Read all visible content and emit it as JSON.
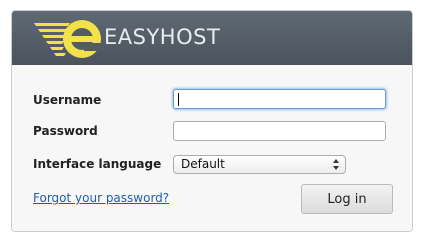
{
  "brand": {
    "logo_icon": "easyhost-e-logo-icon",
    "name": "EASYHOST"
  },
  "form": {
    "username_label": "Username",
    "username_value": "",
    "password_label": "Password",
    "password_value": "",
    "language_label": "Interface language",
    "language_selected": "Default",
    "forgot_link": "Forgot your password?",
    "login_button": "Log in"
  },
  "colors": {
    "header_bg": "#535c65",
    "logo_yellow": "#f2e14a",
    "link_blue": "#1f5fa8",
    "focus_blue": "#6aa0d8"
  }
}
